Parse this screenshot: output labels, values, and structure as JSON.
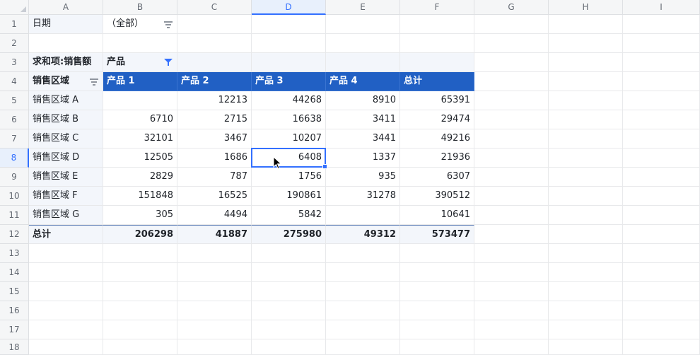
{
  "columns": [
    "A",
    "B",
    "C",
    "D",
    "E",
    "F",
    "G",
    "H",
    "I"
  ],
  "rows": [
    "1",
    "2",
    "3",
    "4",
    "5",
    "6",
    "7",
    "8",
    "9",
    "10",
    "11",
    "12",
    "13",
    "14",
    "15",
    "16",
    "17",
    "18"
  ],
  "selected": {
    "column": "D",
    "row": "8"
  },
  "filter": {
    "label": "日期",
    "value": "（全部）"
  },
  "pivot": {
    "values_label": "求和项:销售额",
    "column_field": "产品",
    "row_field": "销售区域",
    "headers": [
      "产品 1",
      "产品 2",
      "产品 3",
      "产品 4",
      "总计"
    ],
    "data": [
      {
        "region": "销售区域 A",
        "values": [
          "",
          "12213",
          "44268",
          "8910",
          "65391"
        ]
      },
      {
        "region": "销售区域 B",
        "values": [
          "6710",
          "2715",
          "16638",
          "3411",
          "29474"
        ]
      },
      {
        "region": "销售区域 C",
        "values": [
          "32101",
          "3467",
          "10207",
          "3441",
          "49216"
        ]
      },
      {
        "region": "销售区域 D",
        "values": [
          "12505",
          "1686",
          "6408",
          "1337",
          "21936"
        ]
      },
      {
        "region": "销售区域 E",
        "values": [
          "2829",
          "787",
          "1756",
          "935",
          "6307"
        ]
      },
      {
        "region": "销售区域 F",
        "values": [
          "151848",
          "16525",
          "190861",
          "31278",
          "390512"
        ]
      },
      {
        "region": "销售区域 G",
        "values": [
          "305",
          "4494",
          "5842",
          "",
          "10641"
        ]
      }
    ],
    "total": {
      "label": "总计",
      "values": [
        "206298",
        "41887",
        "275980",
        "49312",
        "573477"
      ]
    }
  },
  "colors": {
    "header_blue": "#2160c4",
    "selection": "#3370ff",
    "label_bg": "#f3f6fb"
  }
}
